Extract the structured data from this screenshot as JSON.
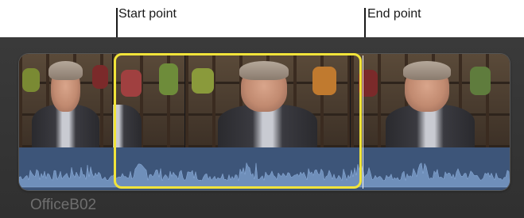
{
  "annotations": {
    "start_label": "Start point",
    "end_label": "End point"
  },
  "clip": {
    "name": "OfficeB02",
    "selection_color": "#f1e43a",
    "audio_color": "#3d5579",
    "frame_count": 4
  },
  "icons": {
    "range_selection": "range-selection",
    "playhead": "playhead-marker"
  }
}
